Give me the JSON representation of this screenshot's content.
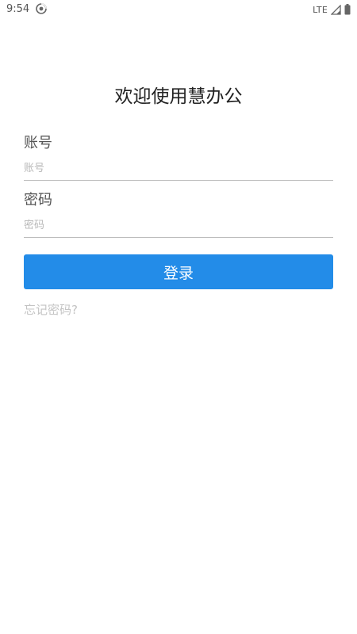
{
  "status_bar": {
    "time": "9:54",
    "network": "LTE",
    "app_icon": "sync-icon",
    "signal_icon": "signal-icon",
    "battery_icon": "battery-icon"
  },
  "login": {
    "title": "欢迎使用慧办公",
    "account_label": "账号",
    "account_placeholder": "账号",
    "account_value": "",
    "password_label": "密码",
    "password_placeholder": "密码",
    "password_value": "",
    "login_button": "登录",
    "forgot_password": "忘记密码?"
  },
  "colors": {
    "primary": "#238ce8",
    "background": "#ffffff",
    "muted_text": "#c4c4c4"
  }
}
